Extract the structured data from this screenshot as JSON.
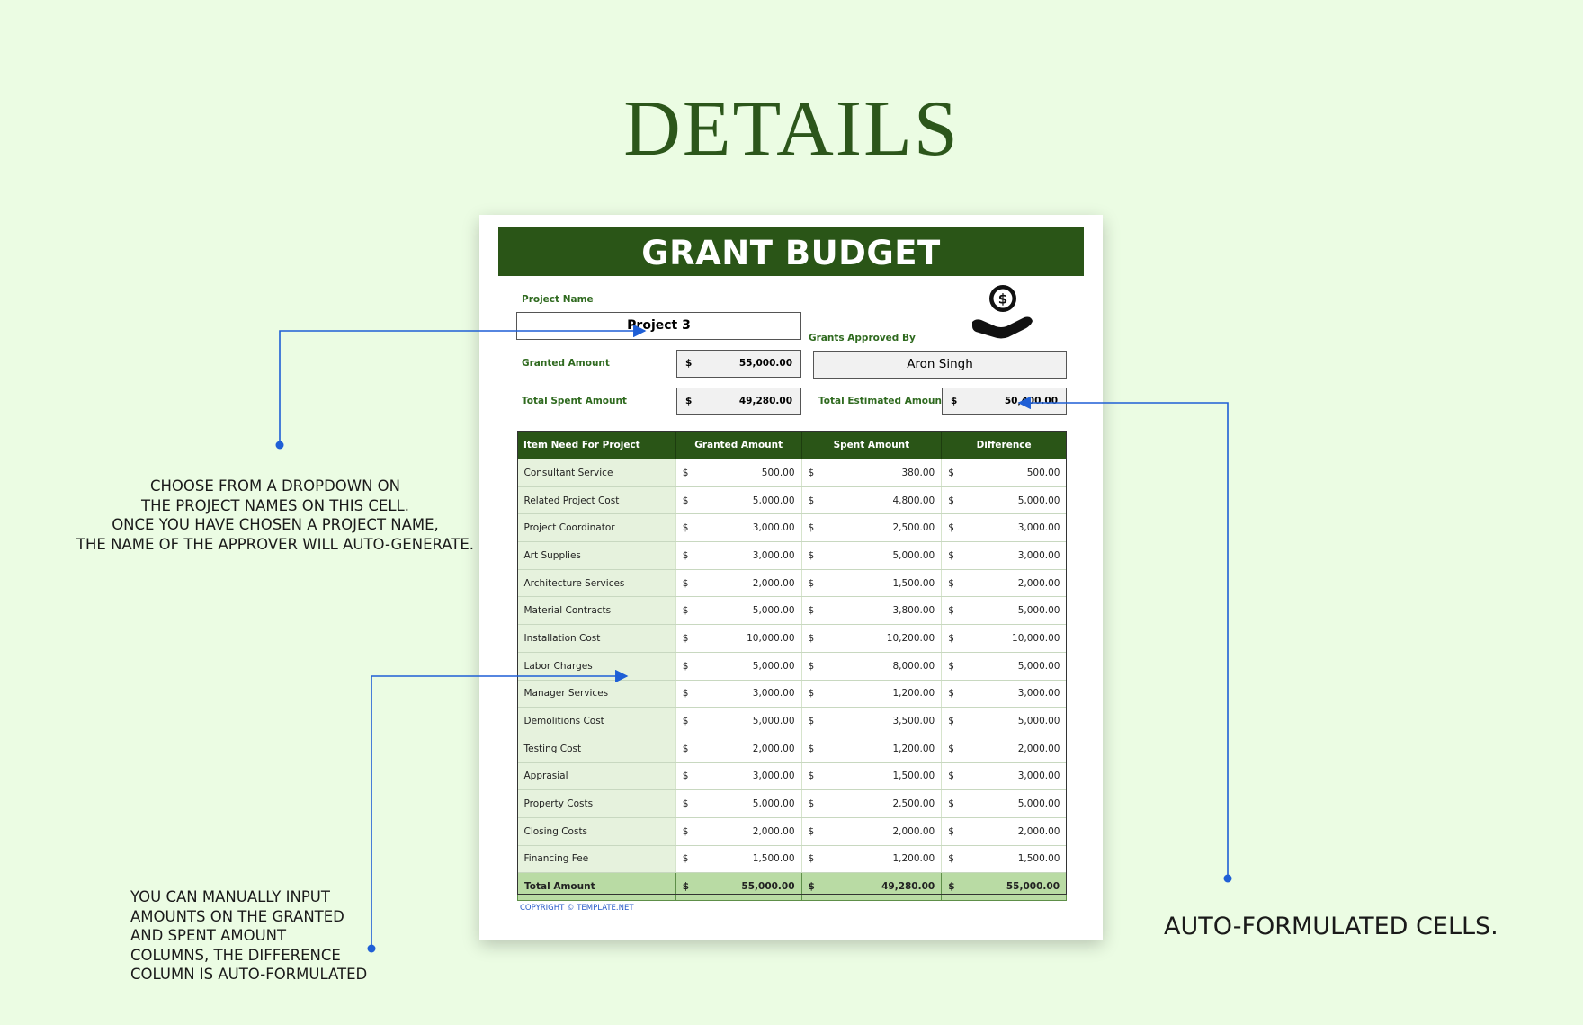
{
  "heading": "DETAILS",
  "sheet": {
    "banner_title": "GRANT BUDGET",
    "project_name_label": "Project Name",
    "project_name_value": "Project 3",
    "grants_approved_by_label": "Grants Approved By",
    "grants_approved_by_value": "Aron Singh",
    "granted_amount_label": "Granted Amount",
    "granted_amount_currency": "$",
    "granted_amount_value": "55,000.00",
    "total_spent_label": "Total Spent Amount",
    "total_spent_currency": "$",
    "total_spent_value": "49,280.00",
    "total_estimated_label": "Total Estimated Amount",
    "total_estimated_currency": "$",
    "total_estimated_value": "50,400.00",
    "icon": "hand-coin-icon",
    "table": {
      "headers": [
        "Item Need For Project",
        "Granted Amount",
        "Spent Amount",
        "Difference"
      ],
      "currency": "$",
      "rows": [
        {
          "item": "Consultant Service",
          "granted": "500.00",
          "spent": "380.00",
          "difference": "500.00"
        },
        {
          "item": "Related Project Cost",
          "granted": "5,000.00",
          "spent": "4,800.00",
          "difference": "5,000.00"
        },
        {
          "item": "Project Coordinator",
          "granted": "3,000.00",
          "spent": "2,500.00",
          "difference": "3,000.00"
        },
        {
          "item": "Art Supplies",
          "granted": "3,000.00",
          "spent": "5,000.00",
          "difference": "3,000.00"
        },
        {
          "item": "Architecture Services",
          "granted": "2,000.00",
          "spent": "1,500.00",
          "difference": "2,000.00"
        },
        {
          "item": "Material Contracts",
          "granted": "5,000.00",
          "spent": "3,800.00",
          "difference": "5,000.00"
        },
        {
          "item": "Installation Cost",
          "granted": "10,000.00",
          "spent": "10,200.00",
          "difference": "10,000.00"
        },
        {
          "item": "Labor Charges",
          "granted": "5,000.00",
          "spent": "8,000.00",
          "difference": "5,000.00"
        },
        {
          "item": "Manager Services",
          "granted": "3,000.00",
          "spent": "1,200.00",
          "difference": "3,000.00"
        },
        {
          "item": "Demolitions Cost",
          "granted": "5,000.00",
          "spent": "3,500.00",
          "difference": "5,000.00"
        },
        {
          "item": "Testing Cost",
          "granted": "2,000.00",
          "spent": "1,200.00",
          "difference": "2,000.00"
        },
        {
          "item": "Apprasial",
          "granted": "3,000.00",
          "spent": "1,500.00",
          "difference": "3,000.00"
        },
        {
          "item": "Property Costs",
          "granted": "5,000.00",
          "spent": "2,500.00",
          "difference": "5,000.00"
        },
        {
          "item": "Closing Costs",
          "granted": "2,000.00",
          "spent": "2,000.00",
          "difference": "2,000.00"
        },
        {
          "item": "Financing Fee",
          "granted": "1,500.00",
          "spent": "1,200.00",
          "difference": "1,500.00"
        }
      ],
      "total": {
        "item": "Total Amount",
        "granted": "55,000.00",
        "spent": "49,280.00",
        "difference": "55,000.00"
      }
    },
    "copyright": "COPYRIGHT © TEMPLATE.NET"
  },
  "notes": {
    "dropdown_note": [
      "CHOOSE FROM A DROPDOWN ON",
      "THE PROJECT NAMES ON THIS CELL.",
      "ONCE YOU HAVE CHOSEN A PROJECT NAME,",
      "THE NAME OF THE APPROVER WILL AUTO-GENERATE."
    ],
    "manual_input_note": [
      "YOU CAN MANUALLY INPUT",
      "AMOUNTS ON THE GRANTED",
      "AND SPENT AMOUNT",
      "COLUMNS, THE DIFFERENCE",
      "COLUMN IS AUTO-FORMULATED"
    ],
    "auto_formulated_note": "AUTO-FORMULATED CELLS."
  },
  "colors": {
    "background": "#ebfce3",
    "heading": "#2c561b",
    "banner": "#2a5517",
    "label_green": "#2f6a1f",
    "item_column": "#e6f2dd",
    "total_row": "#b9dba4",
    "arrow_blue": "#1f5fd6"
  }
}
